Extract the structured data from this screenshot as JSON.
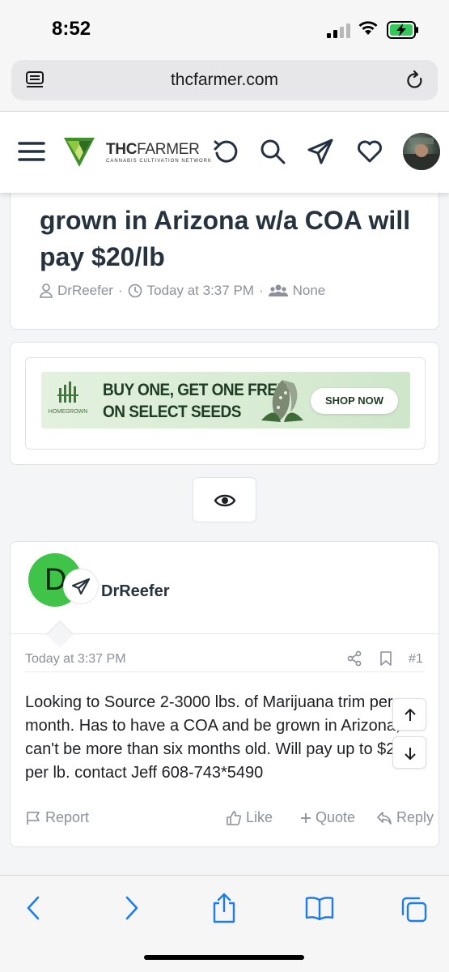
{
  "status_bar": {
    "time": "8:52"
  },
  "browser": {
    "url": "thcfarmer.com"
  },
  "site_header": {
    "logo_bold": "THC",
    "logo_rest": "FARMER",
    "logo_tagline": "CANNABIS CULTIVATION NETWORK"
  },
  "thread": {
    "title": "grown in Arizona w/a COA will pay $20/lb",
    "author": "DrReefer",
    "date": "Today at 3:37 PM",
    "participants": "None"
  },
  "ad": {
    "headline_line1": "BUY ONE, GET ONE FREE",
    "headline_line2": "ON SELECT SEEDS",
    "cta": "SHOP NOW",
    "brand": "HOMEGROWN"
  },
  "post": {
    "avatar_letter": "D",
    "author": "DrReefer",
    "date": "Today at 3:37 PM",
    "number": "#1",
    "body": "Looking to Source 2-3000 lbs. of Marijuana trim per month. Has to have a COA and be grown in Arizona, can't be more than six months old. Will pay up to $20 per lb. contact Jeff 608-743*5490",
    "actions": {
      "report": "Report",
      "like": "Like",
      "quote": "Quote",
      "reply": "Reply"
    }
  },
  "colors": {
    "accent_blue": "#1a7cf0",
    "avatar_green": "#3fc348",
    "title_text": "#27323f",
    "muted_text": "#8a919b"
  }
}
